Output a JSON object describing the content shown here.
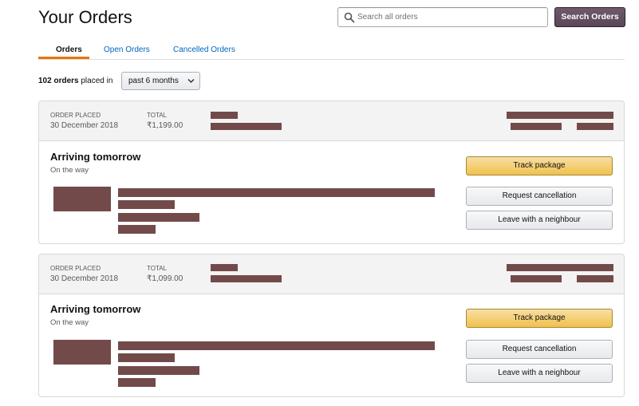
{
  "page": {
    "title": "Your Orders"
  },
  "search": {
    "placeholder": "Search all orders",
    "button_label": "Search Orders"
  },
  "tabs": [
    {
      "label": "Orders",
      "active": true
    },
    {
      "label": "Open Orders",
      "active": false
    },
    {
      "label": "Cancelled Orders",
      "active": false
    }
  ],
  "summary": {
    "count": "102 orders",
    "suffix": "placed in",
    "filter": "past 6 months"
  },
  "labels": {
    "order_placed": "ORDER PLACED",
    "total": "TOTAL"
  },
  "orders": [
    {
      "date": "30 December 2018",
      "total": "₹1,199.00",
      "status": "Arriving tomorrow",
      "substatus": "On the way",
      "actions": {
        "track": "Track package",
        "cancel": "Request cancellation",
        "neighbour": "Leave with a neighbour"
      }
    },
    {
      "date": "30 December 2018",
      "total": "₹1,099.00",
      "status": "Arriving tomorrow",
      "substatus": "On the way",
      "actions": {
        "track": "Track package",
        "cancel": "Request cancellation",
        "neighbour": "Leave with a neighbour"
      }
    }
  ],
  "colors": {
    "redaction": "#734a4a",
    "accent": "#e77600",
    "link": "#0066c0",
    "primary_button": "#f0c14b",
    "search_button": "#5a4657"
  }
}
